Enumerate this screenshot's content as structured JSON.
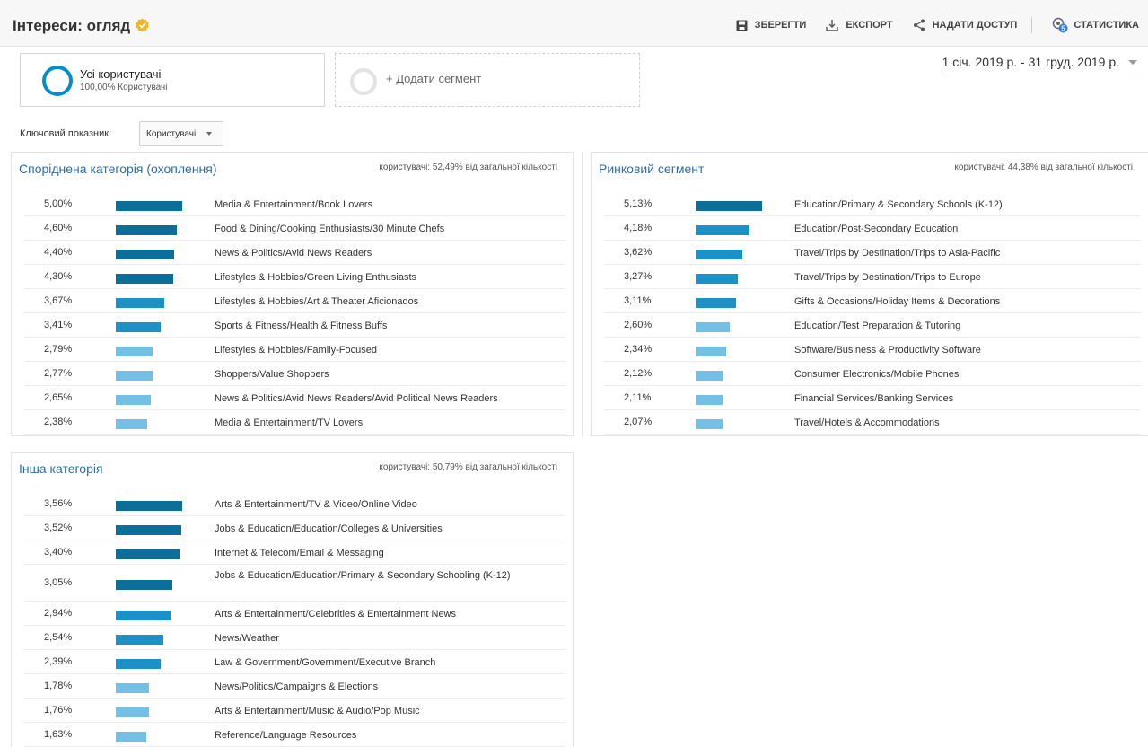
{
  "header": {
    "title": "Інтереси: огляд",
    "actions": {
      "save": "ЗБЕРЕГТИ",
      "export": "ЕКСПОРТ",
      "share": "НАДАТИ ДОСТУП",
      "insights": "СТАТИСТИКА",
      "insights_badge": "5"
    }
  },
  "segments": {
    "all_users": {
      "title": "Усі користувачі",
      "subtitle": "100,00% Користувачі"
    },
    "add": "+ Додати сегмент"
  },
  "date_range": "1 січ. 2019 р. - 31 груд. 2019 р.",
  "metric": {
    "label": "Ключовий показник:",
    "value": "Користувачі"
  },
  "colors": {
    "dark": "#0d6e99",
    "mid": "#1c91c8",
    "light": "#74c0e4",
    "accent": "#058dc7",
    "title_blue": "#2e6da4"
  },
  "panels": {
    "affinity": {
      "title": "Споріднена категорія (охоплення)",
      "subtitle": "користувачі: 52,49% від загальної кількості",
      "rows": [
        {
          "pct": "5,00%",
          "value": 5.0,
          "label": "Media & Entertainment/Book Lovers"
        },
        {
          "pct": "4,60%",
          "value": 4.6,
          "label": "Food & Dining/Cooking Enthusiasts/30 Minute Chefs"
        },
        {
          "pct": "4,40%",
          "value": 4.4,
          "label": "News & Politics/Avid News Readers"
        },
        {
          "pct": "4,30%",
          "value": 4.3,
          "label": "Lifestyles & Hobbies/Green Living Enthusiasts"
        },
        {
          "pct": "3,67%",
          "value": 3.67,
          "label": "Lifestyles & Hobbies/Art & Theater Aficionados"
        },
        {
          "pct": "3,41%",
          "value": 3.41,
          "label": "Sports & Fitness/Health & Fitness Buffs"
        },
        {
          "pct": "2,79%",
          "value": 2.79,
          "label": "Lifestyles & Hobbies/Family-Focused"
        },
        {
          "pct": "2,77%",
          "value": 2.77,
          "label": "Shoppers/Value Shoppers"
        },
        {
          "pct": "2,65%",
          "value": 2.65,
          "label": "News & Politics/Avid News Readers/Avid Political News Readers"
        },
        {
          "pct": "2,38%",
          "value": 2.38,
          "label": "Media & Entertainment/TV Lovers"
        }
      ]
    },
    "in_market": {
      "title": "Ринковий сегмент",
      "subtitle": "користувачі: 44,38% від загальної кількості",
      "rows": [
        {
          "pct": "5,13%",
          "value": 5.13,
          "label": "Education/Primary & Secondary Schools (K-12)"
        },
        {
          "pct": "4,18%",
          "value": 4.18,
          "label": "Education/Post-Secondary Education"
        },
        {
          "pct": "3,62%",
          "value": 3.62,
          "label": "Travel/Trips by Destination/Trips to Asia-Pacific"
        },
        {
          "pct": "3,27%",
          "value": 3.27,
          "label": "Travel/Trips by Destination/Trips to Europe"
        },
        {
          "pct": "3,11%",
          "value": 3.11,
          "label": "Gifts & Occasions/Holiday Items & Decorations"
        },
        {
          "pct": "2,60%",
          "value": 2.6,
          "label": "Education/Test Preparation & Tutoring"
        },
        {
          "pct": "2,34%",
          "value": 2.34,
          "label": "Software/Business & Productivity Software"
        },
        {
          "pct": "2,12%",
          "value": 2.12,
          "label": "Consumer Electronics/Mobile Phones"
        },
        {
          "pct": "2,11%",
          "value": 2.11,
          "label": "Financial Services/Banking Services"
        },
        {
          "pct": "2,07%",
          "value": 2.07,
          "label": "Travel/Hotels & Accommodations"
        }
      ]
    },
    "other": {
      "title": "Інша категорія",
      "subtitle": "користувачі: 50,79% від загальної кількості",
      "rows": [
        {
          "pct": "3,56%",
          "value": 3.56,
          "label": "Arts & Entertainment/TV & Video/Online Video"
        },
        {
          "pct": "3,52%",
          "value": 3.52,
          "label": "Jobs & Education/Education/Colleges & Universities"
        },
        {
          "pct": "3,40%",
          "value": 3.4,
          "label": "Internet & Telecom/Email & Messaging"
        },
        {
          "pct": "3,05%",
          "value": 3.05,
          "label": "Jobs & Education/Education/Primary & Secondary Schooling (K-12)"
        },
        {
          "pct": "2,94%",
          "value": 2.94,
          "label": "Arts & Entertainment/Celebrities & Entertainment News"
        },
        {
          "pct": "2,54%",
          "value": 2.54,
          "label": "News/Weather"
        },
        {
          "pct": "2,39%",
          "value": 2.39,
          "label": "Law & Government/Government/Executive Branch"
        },
        {
          "pct": "1,78%",
          "value": 1.78,
          "label": "News/Politics/Campaigns & Elections"
        },
        {
          "pct": "1,76%",
          "value": 1.76,
          "label": "Arts & Entertainment/Music & Audio/Pop Music"
        },
        {
          "pct": "1,63%",
          "value": 1.63,
          "label": "Reference/Language Resources"
        }
      ]
    }
  }
}
